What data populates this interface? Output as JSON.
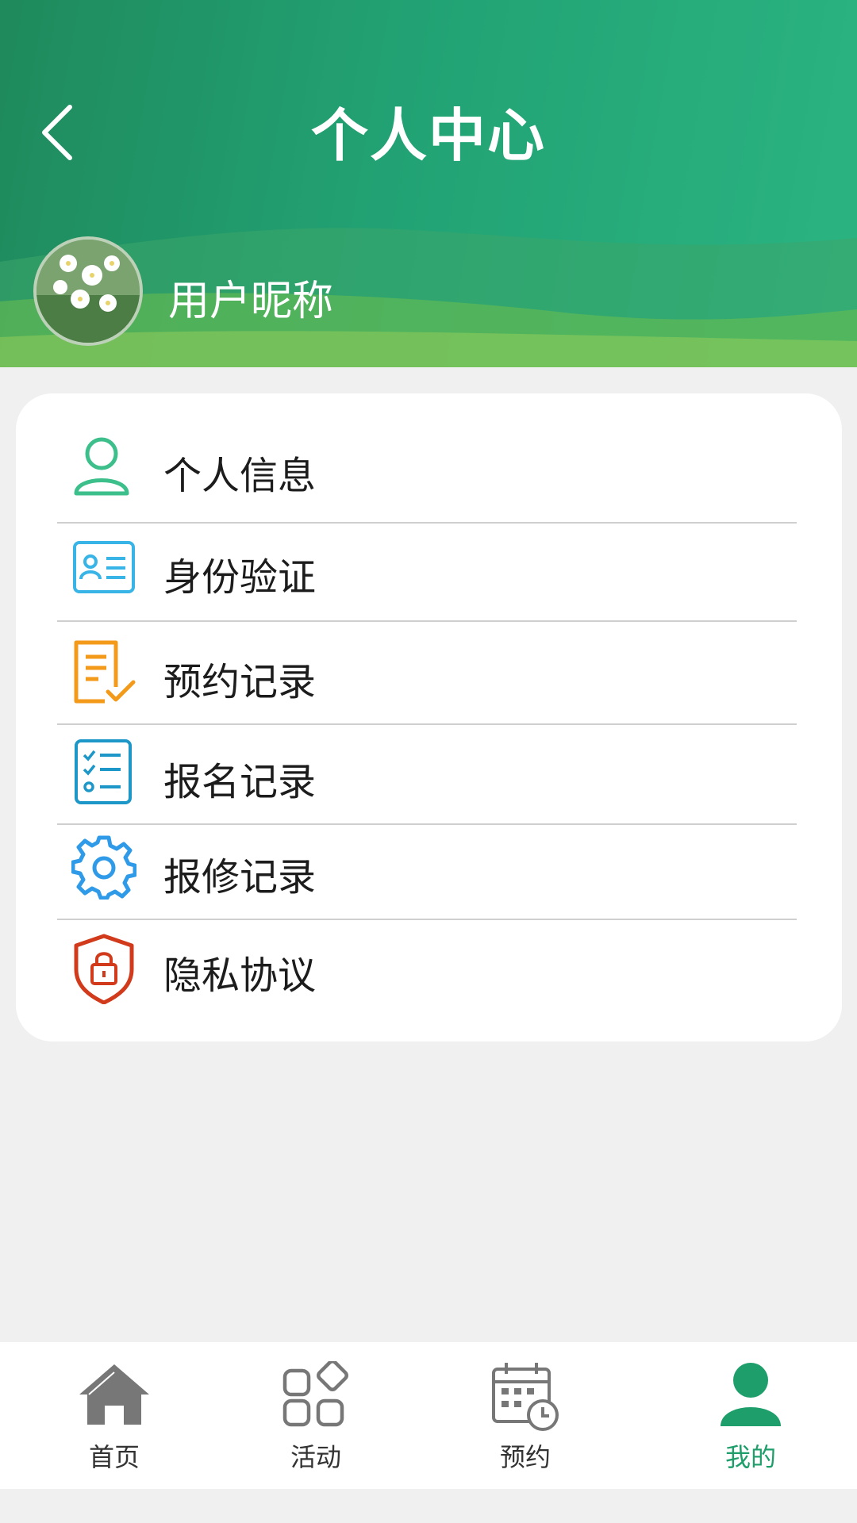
{
  "header": {
    "title": "个人中心",
    "nickname": "用户昵称"
  },
  "menu": {
    "items": [
      {
        "label": "个人信息",
        "icon": "user-icon",
        "color": "#3cbf8a"
      },
      {
        "label": "身份验证",
        "icon": "id-card-icon",
        "color": "#39b4e6"
      },
      {
        "label": "预约记录",
        "icon": "document-check-icon",
        "color": "#f39a1b"
      },
      {
        "label": "报名记录",
        "icon": "checklist-icon",
        "color": "#1c97c8"
      },
      {
        "label": "报修记录",
        "icon": "gear-icon",
        "color": "#2f9be8"
      },
      {
        "label": "隐私协议",
        "icon": "shield-lock-icon",
        "color": "#d23a1c"
      }
    ]
  },
  "tabbar": {
    "items": [
      {
        "label": "首页",
        "icon": "home-icon"
      },
      {
        "label": "活动",
        "icon": "apps-icon"
      },
      {
        "label": "预约",
        "icon": "calendar-clock-icon"
      },
      {
        "label": "我的",
        "icon": "user-solid-icon",
        "active": true
      }
    ],
    "active_color": "#1e9e6a",
    "inactive_color": "#777777"
  }
}
